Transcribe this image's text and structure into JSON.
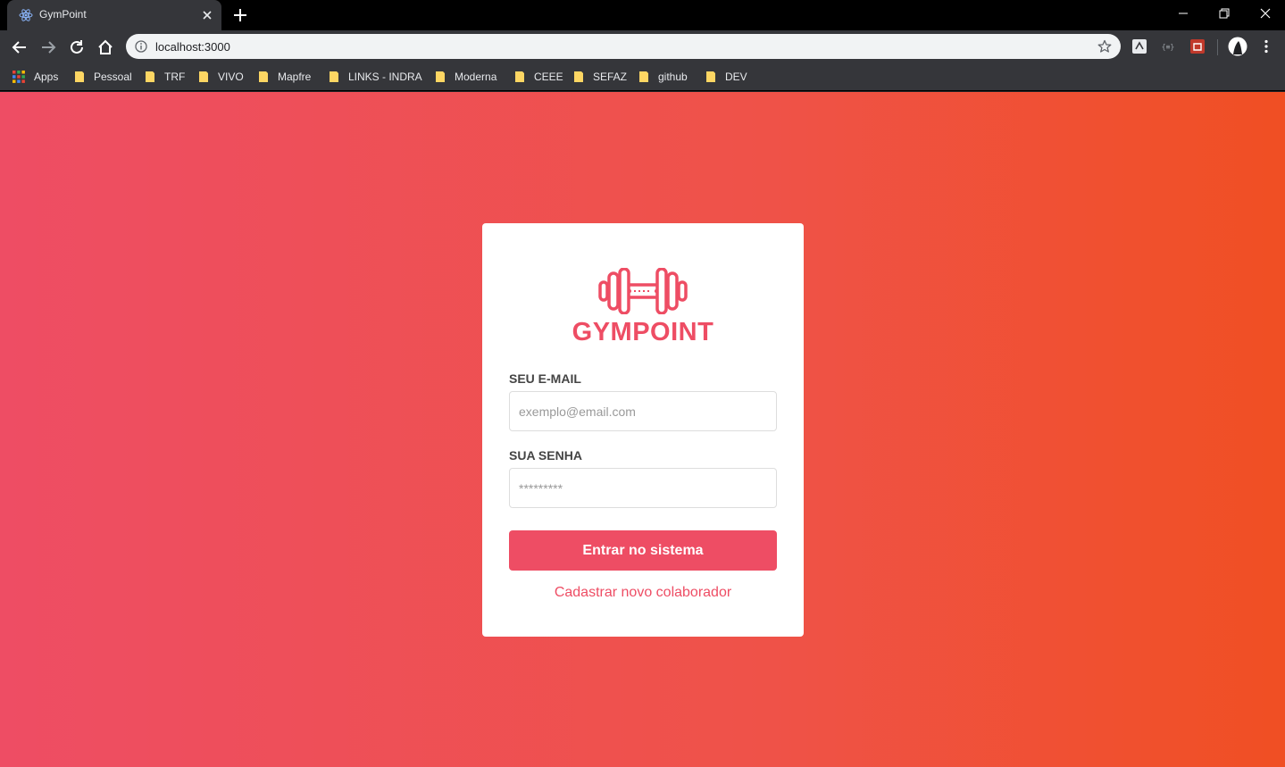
{
  "browser": {
    "tab_title": "GymPoint",
    "url": "localhost:3000",
    "icons": [
      "react-favicon-icon",
      "close-tab-icon",
      "new-tab-icon",
      "minimize-icon",
      "restore-icon",
      "close-window-icon",
      "back-icon",
      "forward-icon",
      "reload-icon",
      "home-icon",
      "info-icon",
      "star-icon",
      "profile-avatar",
      "menu-kebab-icon"
    ]
  },
  "bookmarks": {
    "apps_label": "Apps",
    "items": [
      {
        "label": "Pessoal"
      },
      {
        "label": "TRF"
      },
      {
        "label": "VIVO"
      },
      {
        "label": "Mapfre"
      },
      {
        "label": "LINKS - INDRA"
      },
      {
        "label": "Moderna"
      },
      {
        "label": "CEEE"
      },
      {
        "label": "SEFAZ"
      },
      {
        "label": "github"
      },
      {
        "label": "DEV"
      }
    ]
  },
  "login": {
    "brand": "GYMPOINT",
    "email_label": "SEU E-MAIL",
    "email_placeholder": "exemplo@email.com",
    "password_label": "SUA SENHA",
    "password_placeholder": "*********",
    "submit_label": "Entrar no sistema",
    "register_link": "Cadastrar novo colaborador"
  },
  "colors": {
    "accent": "#ee4d64",
    "gradient_start": "#ee4d64",
    "gradient_end": "#f04f23",
    "card_bg": "#ffffff"
  }
}
